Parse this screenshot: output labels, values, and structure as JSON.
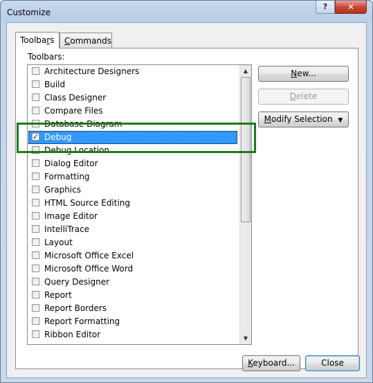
{
  "window": {
    "title": "Customize",
    "help_glyph": "?",
    "close_glyph": "✕"
  },
  "tabs": [
    {
      "label": "Toolbars",
      "active": true
    },
    {
      "label": "Commands",
      "active": false
    }
  ],
  "toolbars_label": "Toolbars:",
  "toolbars": [
    {
      "label": "Architecture Designers",
      "checked": false
    },
    {
      "label": "Build",
      "checked": false
    },
    {
      "label": "Class Designer",
      "checked": false
    },
    {
      "label": "Compare Files",
      "checked": false
    },
    {
      "label": "Database Diagram",
      "checked": false
    },
    {
      "label": "Debug",
      "checked": true,
      "selected": true
    },
    {
      "label": "Debug Location",
      "checked": false
    },
    {
      "label": "Dialog Editor",
      "checked": false
    },
    {
      "label": "Formatting",
      "checked": false
    },
    {
      "label": "Graphics",
      "checked": false
    },
    {
      "label": "HTML Source Editing",
      "checked": false
    },
    {
      "label": "Image Editor",
      "checked": false
    },
    {
      "label": "IntelliTrace",
      "checked": false
    },
    {
      "label": "Layout",
      "checked": false
    },
    {
      "label": "Microsoft Office Excel",
      "checked": false
    },
    {
      "label": "Microsoft Office Word",
      "checked": false
    },
    {
      "label": "Query Designer",
      "checked": false
    },
    {
      "label": "Report",
      "checked": false
    },
    {
      "label": "Report Borders",
      "checked": false
    },
    {
      "label": "Report Formatting",
      "checked": false
    },
    {
      "label": "Ribbon Editor",
      "checked": false
    }
  ],
  "buttons": {
    "new": "New...",
    "delete": "Delete",
    "modify_selection": "Modify Selection",
    "keyboard": "Keyboard...",
    "close": "Close"
  },
  "colors": {
    "selection": "#3399ff",
    "highlight_box": "#1c7a1c"
  }
}
